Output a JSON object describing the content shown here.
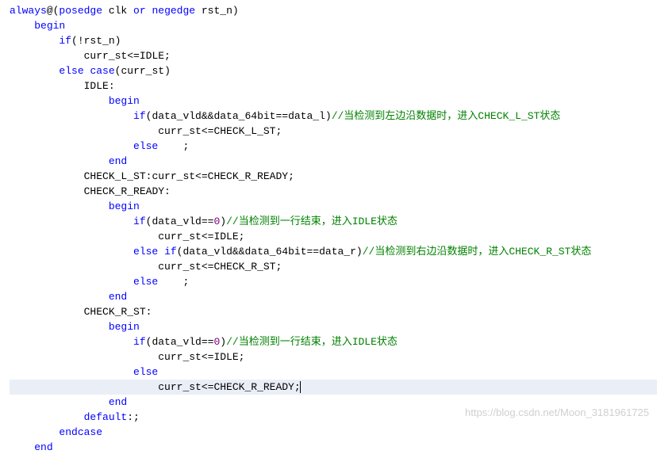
{
  "code": {
    "lines": [
      {
        "indent": 0,
        "segments": [
          {
            "t": "always",
            "c": "kw"
          },
          {
            "t": "@(",
            "c": "op"
          },
          {
            "t": "posedge",
            "c": "kw"
          },
          {
            "t": " clk ",
            "c": "ident"
          },
          {
            "t": "or",
            "c": "kw"
          },
          {
            "t": " ",
            "c": "ident"
          },
          {
            "t": "negedge",
            "c": "kw"
          },
          {
            "t": " rst_n)",
            "c": "ident"
          }
        ]
      },
      {
        "indent": 1,
        "segments": [
          {
            "t": "begin",
            "c": "kw"
          }
        ]
      },
      {
        "indent": 2,
        "segments": [
          {
            "t": "if",
            "c": "kw"
          },
          {
            "t": "(!rst_n)",
            "c": "ident"
          }
        ]
      },
      {
        "indent": 3,
        "segments": [
          {
            "t": "curr_st<=IDLE;",
            "c": "ident"
          }
        ]
      },
      {
        "indent": 2,
        "segments": [
          {
            "t": "else",
            "c": "kw"
          },
          {
            "t": " ",
            "c": "ident"
          },
          {
            "t": "case",
            "c": "kw"
          },
          {
            "t": "(curr_st)",
            "c": "ident"
          }
        ]
      },
      {
        "indent": 3,
        "segments": [
          {
            "t": "IDLE:",
            "c": "ident"
          }
        ]
      },
      {
        "indent": 4,
        "segments": [
          {
            "t": "begin",
            "c": "kw"
          }
        ]
      },
      {
        "indent": 5,
        "segments": [
          {
            "t": "if",
            "c": "kw"
          },
          {
            "t": "(data_vld&&data_64bit==data_l)",
            "c": "ident"
          },
          {
            "t": "//当检测到左边沿数据时，进入CHECK_L_ST状态",
            "c": "comment"
          }
        ]
      },
      {
        "indent": 6,
        "segments": [
          {
            "t": "curr_st<=CHECK_L_ST;",
            "c": "ident"
          }
        ]
      },
      {
        "indent": 5,
        "segments": [
          {
            "t": "else",
            "c": "kw"
          },
          {
            "t": "    ;",
            "c": "ident"
          }
        ]
      },
      {
        "indent": 4,
        "segments": [
          {
            "t": "end",
            "c": "kw"
          }
        ]
      },
      {
        "indent": 3,
        "segments": [
          {
            "t": "CHECK_L_ST:curr_st<=CHECK_R_READY;",
            "c": "ident"
          }
        ]
      },
      {
        "indent": 3,
        "segments": [
          {
            "t": "CHECK_R_READY:",
            "c": "ident"
          }
        ]
      },
      {
        "indent": 4,
        "segments": [
          {
            "t": "begin",
            "c": "kw"
          }
        ]
      },
      {
        "indent": 5,
        "segments": [
          {
            "t": "if",
            "c": "kw"
          },
          {
            "t": "(data_vld==",
            "c": "ident"
          },
          {
            "t": "0",
            "c": "num"
          },
          {
            "t": ")",
            "c": "ident"
          },
          {
            "t": "//当检测到一行结束，进入IDLE状态",
            "c": "comment"
          }
        ]
      },
      {
        "indent": 6,
        "segments": [
          {
            "t": "curr_st<=IDLE;",
            "c": "ident"
          }
        ]
      },
      {
        "indent": 5,
        "segments": [
          {
            "t": "else",
            "c": "kw"
          },
          {
            "t": " ",
            "c": "ident"
          },
          {
            "t": "if",
            "c": "kw"
          },
          {
            "t": "(data_vld&&data_64bit==data_r)",
            "c": "ident"
          },
          {
            "t": "//当检测到右边沿数据时，进入CHECK_R_ST状态",
            "c": "comment"
          }
        ]
      },
      {
        "indent": 6,
        "segments": [
          {
            "t": "curr_st<=CHECK_R_ST;",
            "c": "ident"
          }
        ]
      },
      {
        "indent": 5,
        "segments": [
          {
            "t": "else",
            "c": "kw"
          },
          {
            "t": "    ;",
            "c": "ident"
          }
        ]
      },
      {
        "indent": 4,
        "segments": [
          {
            "t": "end",
            "c": "kw"
          }
        ]
      },
      {
        "indent": 3,
        "segments": [
          {
            "t": "CHECK_R_ST:",
            "c": "ident"
          }
        ]
      },
      {
        "indent": 4,
        "segments": [
          {
            "t": "begin",
            "c": "kw"
          }
        ]
      },
      {
        "indent": 5,
        "segments": [
          {
            "t": "if",
            "c": "kw"
          },
          {
            "t": "(data_vld==",
            "c": "ident"
          },
          {
            "t": "0",
            "c": "num"
          },
          {
            "t": ")",
            "c": "ident"
          },
          {
            "t": "//当检测到一行结束，进入IDLE状态",
            "c": "comment"
          }
        ]
      },
      {
        "indent": 6,
        "segments": [
          {
            "t": "curr_st<=IDLE;",
            "c": "ident"
          }
        ]
      },
      {
        "indent": 5,
        "segments": [
          {
            "t": "else",
            "c": "kw"
          }
        ]
      },
      {
        "indent": 6,
        "highlighted": true,
        "cursor": true,
        "segments": [
          {
            "t": "curr_st<=CHECK_R_READY;",
            "c": "ident"
          }
        ]
      },
      {
        "indent": 4,
        "segments": [
          {
            "t": "end",
            "c": "kw"
          }
        ]
      },
      {
        "indent": 3,
        "segments": [
          {
            "t": "default",
            "c": "kw"
          },
          {
            "t": ":;",
            "c": "ident"
          }
        ]
      },
      {
        "indent": 2,
        "segments": [
          {
            "t": "endcase",
            "c": "kw"
          }
        ]
      },
      {
        "indent": 1,
        "segments": [
          {
            "t": "end",
            "c": "kw"
          }
        ]
      }
    ]
  },
  "watermark": "https://blog.csdn.net/Moon_3181961725",
  "indentUnit": "    "
}
